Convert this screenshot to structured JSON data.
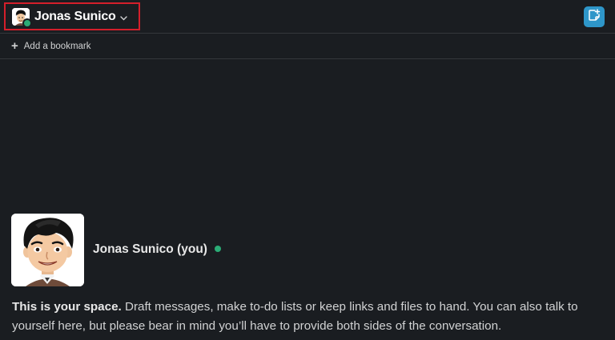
{
  "header": {
    "channel_name": "Jonas Sunico",
    "chevron_icon": "chevron-down-icon",
    "canvas_icon": "canvas-note-icon",
    "accent_color": "#2e96c9",
    "highlight_color": "#d41f2b"
  },
  "bookmarks": {
    "plus_icon": "+",
    "add_label": "Add a bookmark"
  },
  "intro": {
    "name": "Jonas Sunico (you)",
    "presence_color": "#2bac76",
    "message_bold": "This is your space.",
    "message_rest": " Draft messages, make to-do lists or keep links and files to hand. You can also talk to yourself here, but please bear in mind you’ll have to provide both sides of the conversation."
  }
}
